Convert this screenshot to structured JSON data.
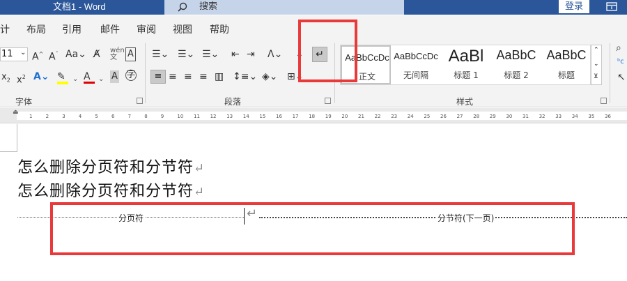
{
  "titlebar": {
    "title": "文档1  -  Word",
    "search_placeholder": "搜索",
    "login_label": "登录"
  },
  "tabs": [
    "计",
    "布局",
    "引用",
    "邮件",
    "审阅",
    "视图",
    "帮助"
  ],
  "ribbon": {
    "font": {
      "size_value": "11",
      "group_label": "字体"
    },
    "paragraph": {
      "group_label": "段落"
    },
    "styles": {
      "group_label": "样式",
      "items": [
        {
          "sample": "AaBbCcDc",
          "name": "正文"
        },
        {
          "sample": "AaBbCcDc",
          "name": "无间隔"
        },
        {
          "sample": "AaBl",
          "name": "标题 1"
        },
        {
          "sample": "AaBbC",
          "name": "标题 2"
        },
        {
          "sample": "AaBbC",
          "name": "标题"
        }
      ]
    }
  },
  "ruler": {
    "ticks": [
      "1",
      "2",
      "3",
      "4",
      "5",
      "6",
      "7",
      "8",
      "9",
      "10",
      "11",
      "12",
      "13",
      "14",
      "15",
      "16",
      "17",
      "18",
      "19",
      "20",
      "21",
      "22",
      "23",
      "24",
      "25",
      "26",
      "27",
      "28",
      "29",
      "30",
      "31",
      "32",
      "33",
      "34",
      "35",
      "36"
    ]
  },
  "document": {
    "lines": [
      "怎么删除分页符和分节符",
      "怎么删除分页符和分节符"
    ],
    "page_break_label": "分页符",
    "section_break_label": "分节符(下一页)"
  },
  "highlight_color": "#e8393b",
  "accent_color": "#2b579a"
}
